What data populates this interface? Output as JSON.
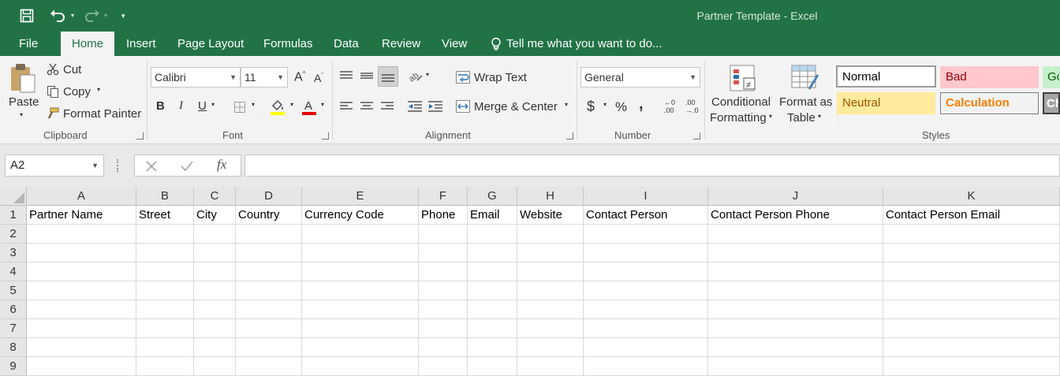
{
  "app": {
    "title": "Partner Template - Excel",
    "colors": {
      "brand": "#217346",
      "bad_fill": "#ffc7ce",
      "neutral_fill": "#ffeb9c",
      "calc_text": "#fa7d00"
    }
  },
  "menu": {
    "tabs": [
      "File",
      "Home",
      "Insert",
      "Page Layout",
      "Formulas",
      "Data",
      "Review",
      "View"
    ],
    "active": "Home",
    "tell_me": "Tell me what you want to do..."
  },
  "ribbon": {
    "clipboard": {
      "paste": "Paste",
      "cut": "Cut",
      "copy": "Copy",
      "format_painter": "Format Painter",
      "label": "Clipboard"
    },
    "font": {
      "name": "Calibri",
      "size": "11",
      "bold": "B",
      "italic": "I",
      "underline": "U",
      "label": "Font"
    },
    "alignment": {
      "wrap_text": "Wrap Text",
      "merge_center": "Merge & Center",
      "label": "Alignment"
    },
    "number": {
      "format": "General",
      "currency": "$",
      "percent": "%",
      "comma": ",",
      "inc_dec": ".00",
      "label": "Number"
    },
    "styles": {
      "conditional_1": "Conditional",
      "conditional_2": "Formatting",
      "format_table_1": "Format as",
      "format_table_2": "Table",
      "normal": "Normal",
      "bad": "Bad",
      "good": "Go",
      "neutral": "Neutral",
      "calculation": "Calculation",
      "check": "Ch",
      "label": "Styles"
    }
  },
  "formula_bar": {
    "name_box": "A2",
    "fx": "fx",
    "value": ""
  },
  "sheet": {
    "columns": [
      "A",
      "B",
      "C",
      "D",
      "E",
      "F",
      "G",
      "H",
      "I",
      "J",
      "K"
    ],
    "rows": [
      "1",
      "2",
      "3",
      "4",
      "5",
      "6",
      "7",
      "8",
      "9"
    ],
    "header_row": [
      "Partner Name",
      "Street",
      "City",
      "Country",
      "Currency Code",
      "Phone",
      "Email",
      "Website",
      "Contact Person",
      "Contact Person Phone",
      "Contact Person Email"
    ]
  }
}
